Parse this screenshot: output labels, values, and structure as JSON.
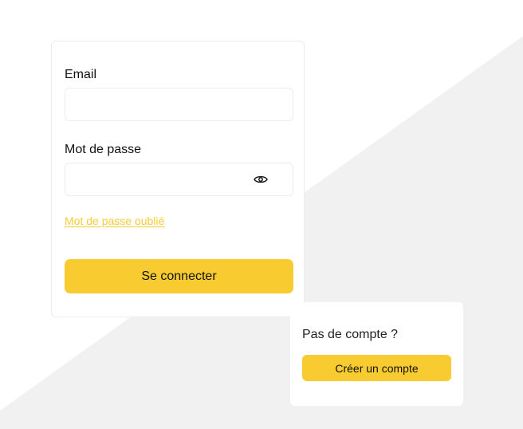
{
  "colors": {
    "accent": "#f8cb31",
    "link": "#f7cc34",
    "background_shape": "#f1f1f1",
    "card_border": "#ececec"
  },
  "login_form": {
    "email": {
      "label": "Email",
      "value": "",
      "placeholder": ""
    },
    "password": {
      "label": "Mot de passe",
      "value": "",
      "placeholder": "",
      "toggle_icon": "eye-icon"
    },
    "forgot_password_link": "Mot de passe oublié",
    "submit_label": "Se connecter"
  },
  "signup_card": {
    "prompt": "Pas de compte ?",
    "button_label": "Créer un compte"
  }
}
